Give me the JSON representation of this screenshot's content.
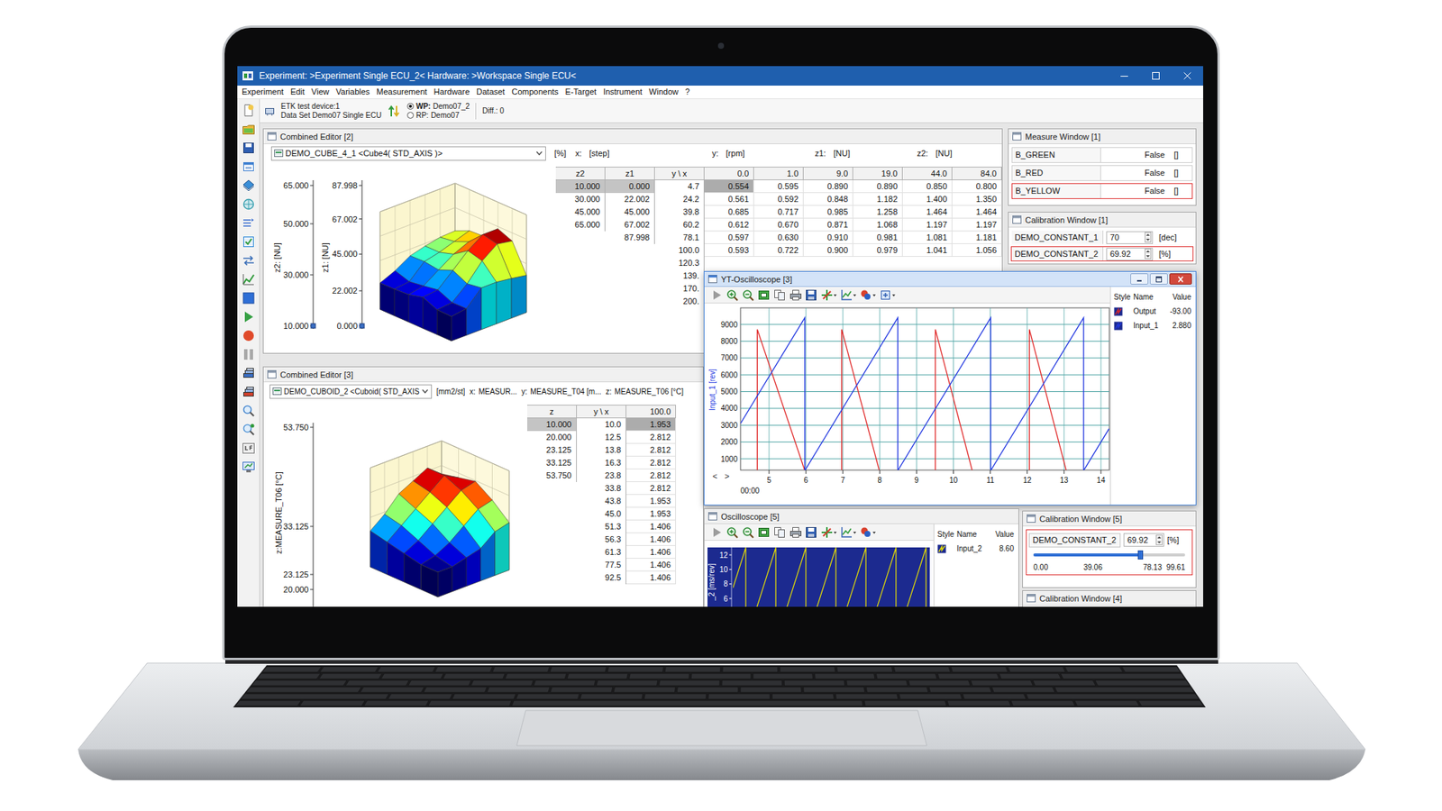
{
  "window": {
    "title": "Experiment: >Experiment Single ECU_2< Hardware: >Workspace Single ECU<"
  },
  "menu": [
    "Experiment",
    "Edit",
    "View",
    "Variables",
    "Measurement",
    "Hardware",
    "Dataset",
    "Components",
    "E-Target",
    "Instrument",
    "Window",
    "?"
  ],
  "toolbar": {
    "device": "ETK test device:1",
    "dataset": "Data Set Demo07 Single ECU",
    "pages": [
      {
        "label": "WP:",
        "value": "Demo07_2",
        "selected": true
      },
      {
        "label": "RP:",
        "value": "Demo07",
        "selected": false
      }
    ],
    "diff": "Diff.: 0"
  },
  "combined_editor_2": {
    "title": "Combined Editor [2]",
    "active": false,
    "variable": "DEMO_CUBE_4_1 <Cube4( STD_AXIS )>",
    "unit": "[%]",
    "axes": [
      {
        "label": "x:",
        "unit": "[step]"
      },
      {
        "label": "y:",
        "unit": "[rpm]"
      },
      {
        "label": "z1:",
        "unit": "[NU]"
      },
      {
        "label": "z2:",
        "unit": "[NU]"
      }
    ],
    "chart": {
      "axes": [
        {
          "label": "z2: [NU]",
          "ticks": [
            "65.000",
            "50.000",
            "30.000",
            "10.000"
          ]
        },
        {
          "label": "z1: [NU]",
          "ticks": [
            "87.998",
            "67.002",
            "45.000",
            "22.002",
            "0.000"
          ]
        }
      ]
    },
    "table": {
      "columns": [
        {
          "header": "z2",
          "cells": [
            {
              "value": "10.000",
              "selected": true
            },
            {
              "value": "30.000",
              "selected": false
            },
            {
              "value": "45.000",
              "selected": false
            },
            {
              "value": "65.000",
              "selected": false
            }
          ]
        },
        {
          "header": "z1",
          "cells": [
            {
              "value": "0.000",
              "selected": true
            },
            {
              "value": "22.002",
              "selected": false
            },
            {
              "value": "45.000",
              "selected": false
            },
            {
              "value": "67.002",
              "selected": false
            },
            {
              "value": "87.998",
              "selected": false
            }
          ]
        },
        {
          "header": "y \\ x",
          "cells": [
            {
              "value": "4.7",
              "selected": false
            },
            {
              "value": "24.2",
              "selected": false
            },
            {
              "value": "39.8",
              "selected": false
            },
            {
              "value": "60.2",
              "selected": false
            },
            {
              "value": "78.1",
              "selected": false
            },
            {
              "value": "100.0",
              "selected": false
            },
            {
              "value": "120.3",
              "selected": false
            },
            {
              "value": "139.",
              "selected": false
            },
            {
              "value": "170.",
              "selected": false
            },
            {
              "value": "200.",
              "selected": false
            }
          ]
        }
      ],
      "x_values": [
        "0.0",
        "1.0",
        "9.0",
        "19.0",
        "44.0",
        "84.0"
      ],
      "rows": [
        [
          {
            "value": "0.554",
            "selected": true
          },
          {
            "value": "0.595",
            "selected": false
          },
          {
            "value": "0.890",
            "selected": false
          },
          {
            "value": "0.890",
            "selected": false
          },
          {
            "value": "0.850",
            "selected": false
          },
          {
            "value": "0.800",
            "selected": false
          }
        ],
        [
          {
            "value": "0.561",
            "selected": false
          },
          {
            "value": "0.592",
            "selected": false
          },
          {
            "value": "0.848",
            "selected": false
          },
          {
            "value": "1.182",
            "selected": false
          },
          {
            "value": "1.400",
            "selected": false
          },
          {
            "value": "1.350",
            "selected": false
          }
        ],
        [
          {
            "value": "0.685",
            "selected": false
          },
          {
            "value": "0.717",
            "selected": false
          },
          {
            "value": "0.985",
            "selected": false
          },
          {
            "value": "1.258",
            "selected": false
          },
          {
            "value": "1.464",
            "selected": false
          },
          {
            "value": "1.464",
            "selected": false
          }
        ],
        [
          {
            "value": "0.612",
            "selected": false
          },
          {
            "value": "0.670",
            "selected": false
          },
          {
            "value": "0.871",
            "selected": false
          },
          {
            "value": "1.068",
            "selected": false
          },
          {
            "value": "1.197",
            "selected": false
          },
          {
            "value": "1.197",
            "selected": false
          }
        ],
        [
          {
            "value": "0.597",
            "selected": false
          },
          {
            "value": "0.630",
            "selected": false
          },
          {
            "value": "0.910",
            "selected": false
          },
          {
            "value": "0.981",
            "selected": false
          },
          {
            "value": "1.081",
            "selected": false
          },
          {
            "value": "1.181",
            "selected": false
          }
        ],
        [
          {
            "value": "0.593",
            "selected": false
          },
          {
            "value": "0.722",
            "selected": false
          },
          {
            "value": "0.900",
            "selected": false
          },
          {
            "value": "0.979",
            "selected": false
          },
          {
            "value": "1.041",
            "selected": false
          },
          {
            "value": "1.056",
            "selected": false
          }
        ]
      ]
    }
  },
  "combined_editor_3": {
    "title": "Combined Editor [3]",
    "active": false,
    "variable": "DEMO_CUBOID_2 <Cuboid( STD_AXIS",
    "unit": "[mm2/st]",
    "axes": [
      {
        "label": "x:",
        "unit": "MEASUR..."
      },
      {
        "label": "y:",
        "unit": "MEASURE_T04 [m..."
      },
      {
        "label": "z:",
        "unit": "MEASURE_T06 [°C]"
      }
    ],
    "chart": {
      "label": "z:MEASURE_T06 [°C]",
      "ticks": [
        "53.750",
        "33.125",
        "23.125",
        "20.000"
      ],
      "surface": [
        [
          1.4,
          1.4,
          1.5,
          1.6,
          1.9,
          2.0
        ],
        [
          1.4,
          1.5,
          1.7,
          2.0,
          2.3,
          2.4
        ],
        [
          1.5,
          1.7,
          2.0,
          2.3,
          2.6,
          2.7
        ],
        [
          1.6,
          1.9,
          2.2,
          2.5,
          2.8,
          2.6
        ],
        [
          1.7,
          2.0,
          2.4,
          2.6,
          2.8,
          2.5
        ]
      ]
    },
    "table": {
      "columns": [
        {
          "header": "z",
          "cells": [
            {
              "value": "10.000",
              "selected": true
            },
            {
              "value": "20.000",
              "selected": false
            },
            {
              "value": "23.125",
              "selected": false
            },
            {
              "value": "33.125",
              "selected": false
            },
            {
              "value": "53.750",
              "selected": false
            }
          ]
        },
        {
          "header": "y \\ x",
          "cells": [
            {
              "value": "10.0",
              "selected": false
            },
            {
              "value": "12.5",
              "selected": false
            },
            {
              "value": "13.8",
              "selected": false
            },
            {
              "value": "16.3",
              "selected": false
            },
            {
              "value": "23.8",
              "selected": false
            },
            {
              "value": "33.8",
              "selected": false
            },
            {
              "value": "43.8",
              "selected": false
            },
            {
              "value": "45.0",
              "selected": false
            },
            {
              "value": "51.3",
              "selected": false
            },
            {
              "value": "56.3",
              "selected": false
            },
            {
              "value": "61.3",
              "selected": false
            },
            {
              "value": "77.5",
              "selected": false
            },
            {
              "value": "92.5",
              "selected": false
            }
          ]
        }
      ],
      "x_values": [
        "100.0"
      ],
      "rows": [
        [
          {
            "value": "1.953",
            "selected": true
          }
        ],
        [
          {
            "value": "2.812",
            "selected": false
          }
        ],
        [
          {
            "value": "2.812",
            "selected": false
          }
        ],
        [
          {
            "value": "2.812",
            "selected": false
          }
        ],
        [
          {
            "value": "2.812",
            "selected": false
          }
        ],
        [
          {
            "value": "2.812",
            "selected": false
          }
        ],
        [
          {
            "value": "1.953",
            "selected": false
          }
        ],
        [
          {
            "value": "1.953",
            "selected": false
          }
        ],
        [
          {
            "value": "1.406",
            "selected": false
          }
        ],
        [
          {
            "value": "1.406",
            "selected": false
          }
        ],
        [
          {
            "value": "1.406",
            "selected": false
          }
        ],
        [
          {
            "value": "1.406",
            "selected": false
          }
        ],
        [
          {
            "value": "1.406",
            "selected": false
          }
        ]
      ]
    }
  },
  "measure_window_1": {
    "title": "Measure Window [1]",
    "active": false,
    "rows": [
      {
        "name": "B_GREEN",
        "value": "False",
        "unit": "[]",
        "selected": false
      },
      {
        "name": "B_RED",
        "value": "False",
        "unit": "[]",
        "selected": false
      },
      {
        "name": "B_YELLOW",
        "value": "False",
        "unit": "[]",
        "selected": true
      }
    ]
  },
  "calibration_window_1": {
    "title": "Calibration Window [1]",
    "active": false,
    "rows": [
      {
        "name": "DEMO_CONSTANT_1",
        "value": "70",
        "unit": "[dec]",
        "selected": false
      },
      {
        "name": "DEMO_CONSTANT_2",
        "value": "69.92",
        "unit": "[%]",
        "selected": true
      }
    ]
  },
  "yt_oscilloscope": {
    "title": "YT-Oscilloscope [3]",
    "active": true,
    "legend": {
      "headers": [
        "Style",
        "Name",
        "Value"
      ],
      "series": [
        {
          "name": "Output",
          "value": "-93.00",
          "color": "#e02828",
          "t": [
            4.68,
            4.68,
            5.97,
            6.97,
            6.97,
            7.99,
            9.51,
            9.51,
            10.51,
            12.06,
            12.06,
            13.06,
            14.22
          ],
          "values": [
            300,
            8700,
            300,
            300,
            8700,
            300,
            300,
            8700,
            300,
            300,
            8700,
            300,
            300
          ]
        },
        {
          "name": "Input_1",
          "value": "2.880",
          "color": "#2238e0",
          "t": [
            4.23,
            5.97,
            5.97,
            8.49,
            8.49,
            11.01,
            11.01,
            13.53,
            13.53,
            14.22
          ],
          "values": [
            3117,
            9400,
            300,
            9400,
            300,
            9400,
            300,
            9400,
            300,
            2792
          ]
        }
      ]
    },
    "y_axis": {
      "label": "Input_1 [rev]",
      "ticks": [
        "9000",
        "8000",
        "7000",
        "6000",
        "5000",
        "4000",
        "3000",
        "2000",
        "1000"
      ]
    },
    "x_axis": {
      "ticks": [
        "5",
        "6",
        "7",
        "8",
        "9",
        "10",
        "11",
        "12",
        "13",
        "14"
      ],
      "origin": "00:00"
    },
    "scroll": [
      "<",
      ">"
    ]
  },
  "oscilloscope_5": {
    "title": "Oscilloscope [5]",
    "active": false,
    "legend": {
      "headers": [
        "Style",
        "Name",
        "Value"
      ],
      "series": [
        {
          "name": "Input_2",
          "value": "8.60",
          "color": "#e8e000",
          "t": [
            0,
            0.425,
            0.425,
            1.425,
            1.425,
            2.425,
            2.425,
            3.425,
            3.425,
            4.425,
            4.425,
            5.425,
            5.425,
            6.425,
            6.425,
            6.55
          ],
          "values": [
            7.48,
            13,
            0,
            13,
            0,
            13,
            0,
            13,
            0,
            13,
            0,
            13,
            0,
            13,
            0,
            1.63
          ]
        }
      ]
    },
    "y_axis": {
      "label": "_2 [ms/rev]",
      "ticks": [
        "12",
        "10",
        "8",
        "6"
      ]
    }
  },
  "calibration_window_5": {
    "title": "Calibration Window [5]",
    "active": false,
    "name": "DEMO_CONSTANT_2",
    "value": "69.92",
    "unit": "[%]",
    "selected": true,
    "level": 0.702,
    "scale": [
      "0.00",
      "39.06",
      "78.13",
      "99.61"
    ]
  },
  "calibration_window_4": {
    "title": "Calibration Window [4]",
    "active": false
  }
}
